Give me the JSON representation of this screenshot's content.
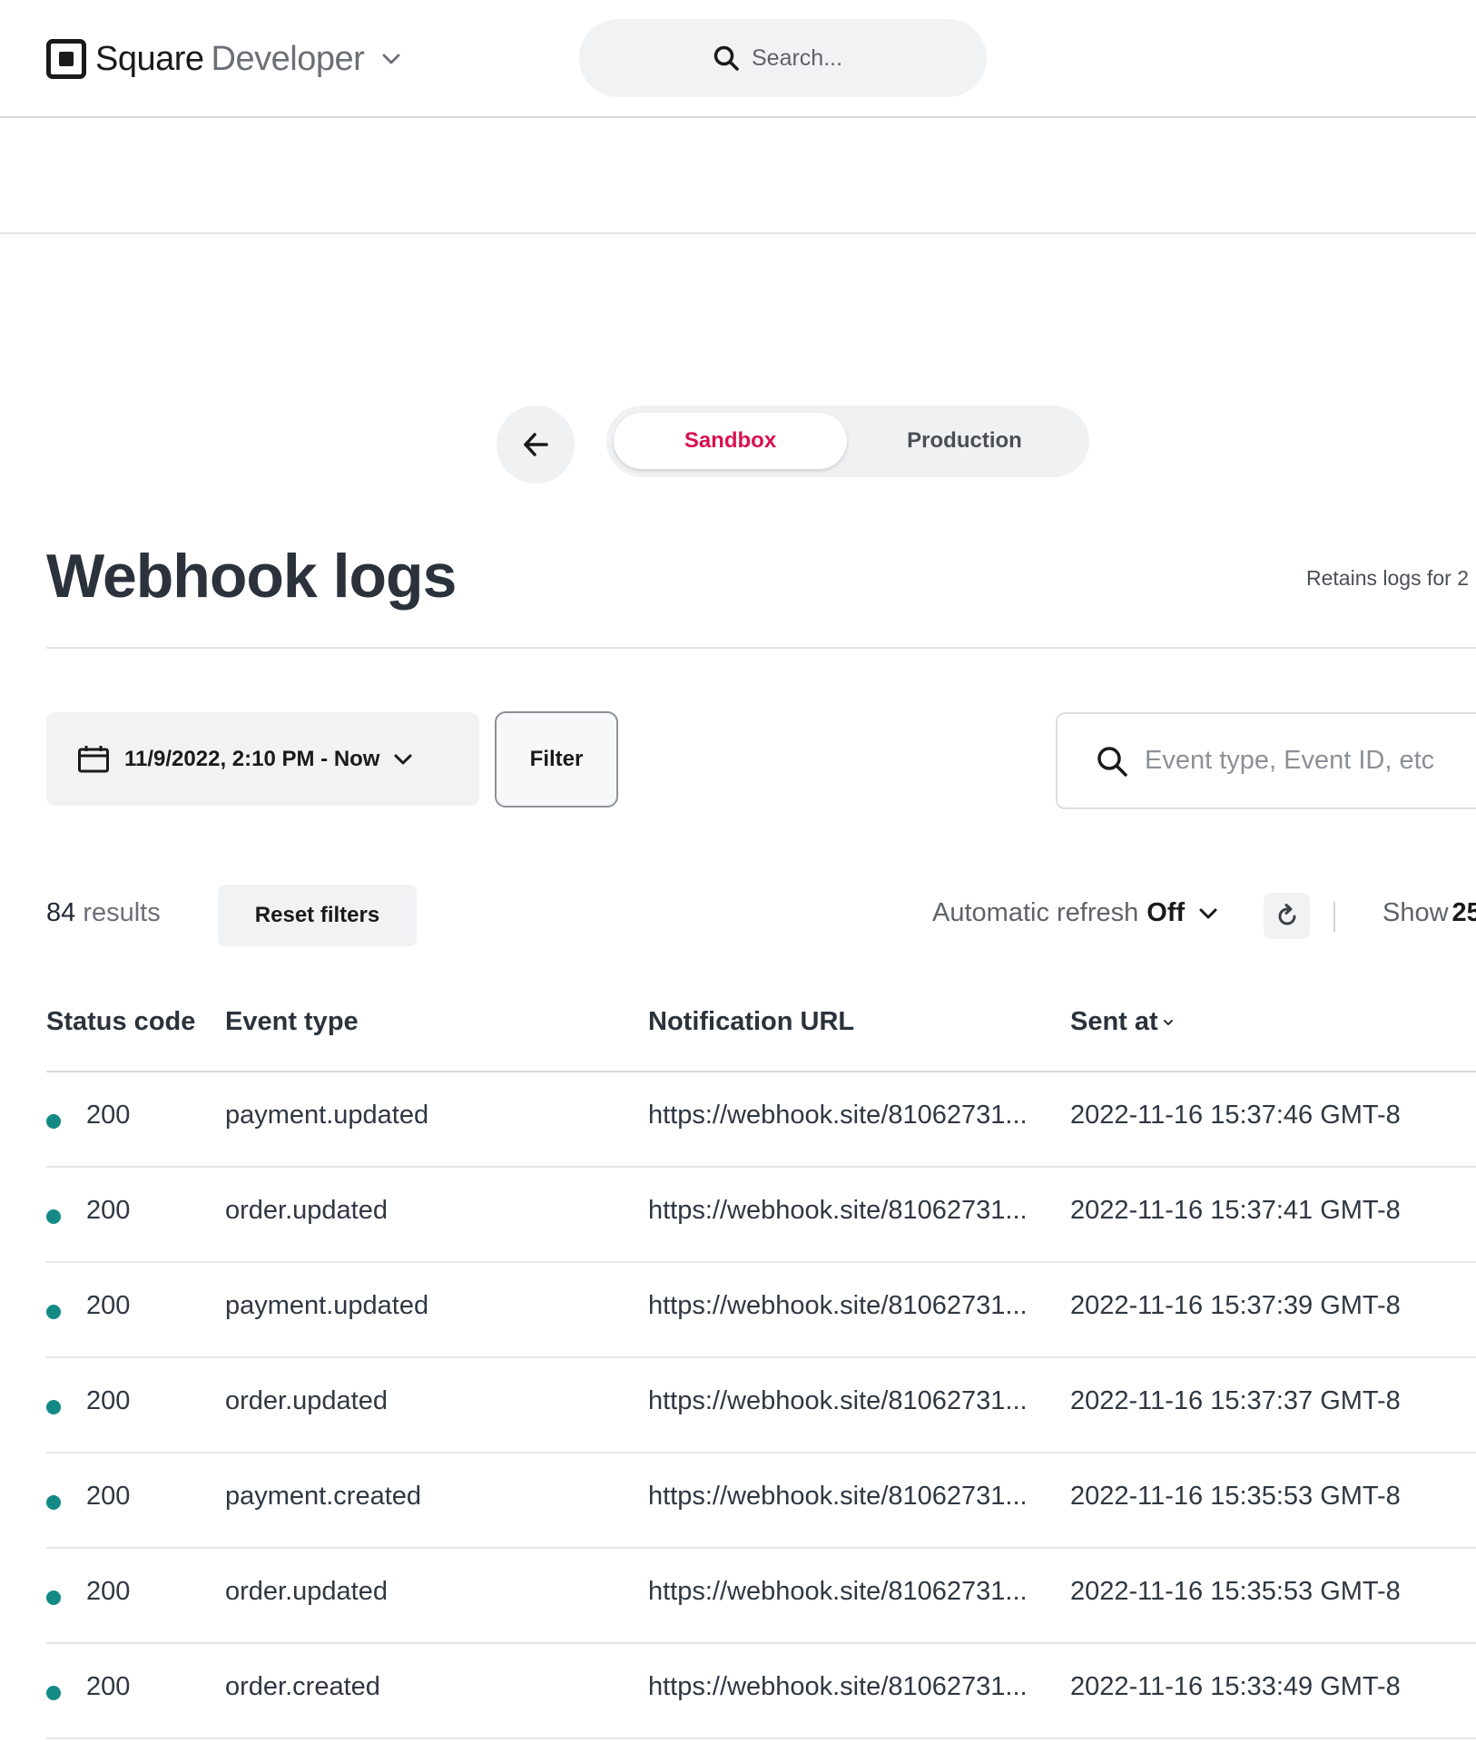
{
  "header": {
    "brand_square": "Square",
    "brand_developer": "Developer",
    "search_placeholder": "Search..."
  },
  "env_toggle": {
    "active": "Sandbox",
    "inactive": "Production"
  },
  "page": {
    "title": "Webhook logs",
    "retains_text": "Retains logs for 2"
  },
  "filters": {
    "date_range": "11/9/2022, 2:10 PM - Now",
    "filter_label": "Filter",
    "search_placeholder": "Event type, Event ID, etc"
  },
  "toolbar": {
    "results_count": "84",
    "results_label": " results",
    "reset_label": "Reset filters",
    "auto_refresh_label": "Automatic refresh",
    "auto_refresh_value": "Off",
    "show_label": "Show",
    "show_value": "25"
  },
  "table": {
    "columns": {
      "status": "Status code",
      "event_type": "Event type",
      "url": "Notification URL",
      "sent_at": "Sent at"
    },
    "status_color": "#138a85",
    "rows": [
      {
        "status": "200",
        "event_type": "payment.updated",
        "url": "https://webhook.site/81062731...",
        "sent_at": "2022-11-16 15:37:46 GMT-8"
      },
      {
        "status": "200",
        "event_type": "order.updated",
        "url": "https://webhook.site/81062731...",
        "sent_at": "2022-11-16 15:37:41 GMT-8"
      },
      {
        "status": "200",
        "event_type": "payment.updated",
        "url": "https://webhook.site/81062731...",
        "sent_at": "2022-11-16 15:37:39 GMT-8"
      },
      {
        "status": "200",
        "event_type": "order.updated",
        "url": "https://webhook.site/81062731...",
        "sent_at": "2022-11-16 15:37:37 GMT-8"
      },
      {
        "status": "200",
        "event_type": "payment.created",
        "url": "https://webhook.site/81062731...",
        "sent_at": "2022-11-16 15:35:53 GMT-8"
      },
      {
        "status": "200",
        "event_type": "order.updated",
        "url": "https://webhook.site/81062731...",
        "sent_at": "2022-11-16 15:35:53 GMT-8"
      },
      {
        "status": "200",
        "event_type": "order.created",
        "url": "https://webhook.site/81062731...",
        "sent_at": "2022-11-16 15:33:49 GMT-8"
      }
    ]
  }
}
